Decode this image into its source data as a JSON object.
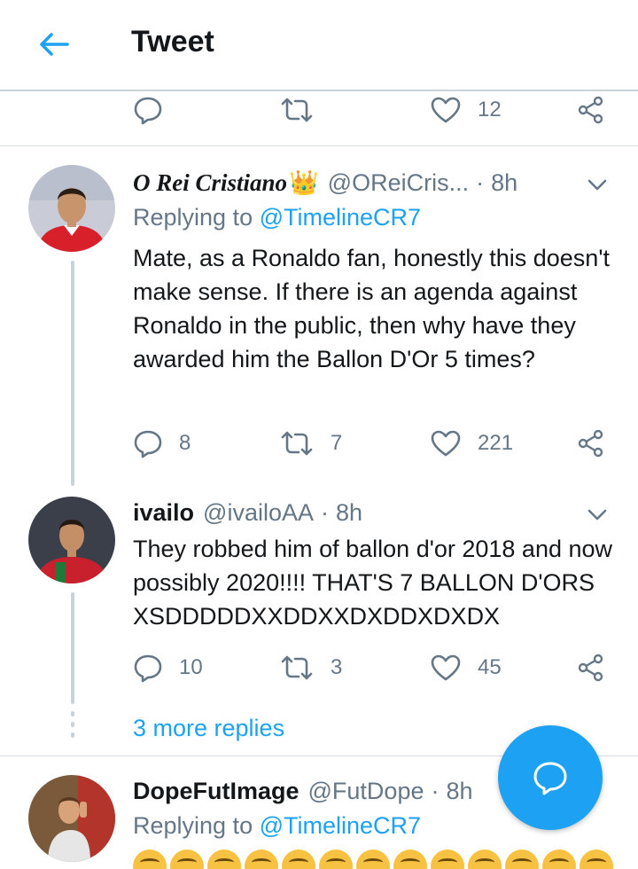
{
  "header": {
    "title": "Tweet"
  },
  "top_actions": {
    "likes": "12"
  },
  "tweets": [
    {
      "name": "O Rei Cristiano",
      "name_emoji": "👑",
      "handle": "@OReiCris...",
      "time": "8h",
      "replying_label": "Replying to",
      "replying_to": "@TimelineCR7",
      "text": "Mate, as a Ronaldo fan, honestly this doesn't make sense. If there is an agenda against Ronaldo in the public, then why have they awarded him the Ballon D'Or 5 times?",
      "replies": "8",
      "retweets": "7",
      "likes": "221"
    },
    {
      "name": "ivailo",
      "handle": "@ivailoAA",
      "time": "8h",
      "text": "They robbed him of ballon d'or 2018 and now possibly 2020!!!! THAT'S 7 BALLON D'ORS XSDDDDDXXDDXXDXDDXDXDX",
      "replies": "10",
      "retweets": "3",
      "likes": "45"
    },
    {
      "name": "DopeFutImage",
      "handle": "@FutDope",
      "time": "8h",
      "replying_label": "Replying to",
      "replying_to": "@TimelineCR7"
    }
  ],
  "more_replies": "3 more replies",
  "colors": {
    "accent": "#1da1f2",
    "secondary_text": "#657786",
    "primary_text": "#14171a"
  },
  "icons": [
    "back-arrow-icon",
    "reply-icon",
    "retweet-icon",
    "heart-icon",
    "share-icon",
    "chevron-down-icon",
    "compose-reply-icon"
  ]
}
